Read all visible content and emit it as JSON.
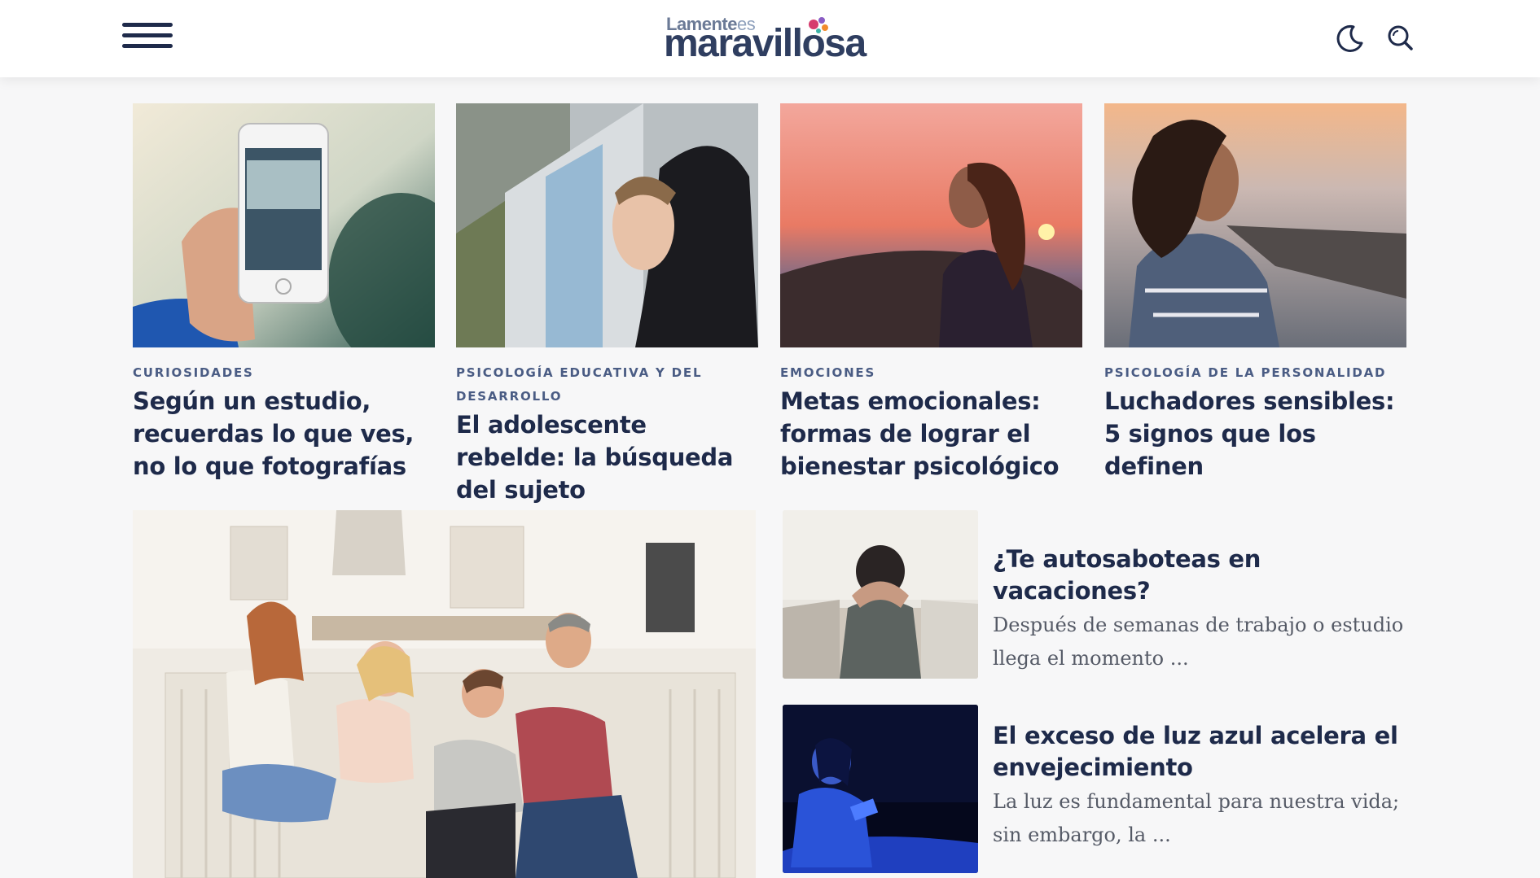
{
  "header": {
    "logo_small": "Lamente",
    "logo_small_es": "es",
    "logo_main": "maravillosa"
  },
  "cards": [
    {
      "category": "Curiosidades",
      "title": "Según un estudio, recuerdas lo que ves, no lo que fotografías"
    },
    {
      "category": "Psicología educativa y del desarrollo",
      "title": "El adolescente rebelde: la búsqueda del sujeto"
    },
    {
      "category": "Emociones",
      "title": "Metas emocionales: formas de lograr el bienestar psicológico"
    },
    {
      "category": "Psicología de la personalidad",
      "title": "Luchadores sensibles: 5 signos que los definen"
    }
  ],
  "side_items": [
    {
      "title": "¿Te autosaboteas en vacaciones?",
      "excerpt": "Después de semanas de trabajo o estudio llega el momento ..."
    },
    {
      "title": "El exceso de luz azul acelera el envejecimiento",
      "excerpt": "La luz es fundamental para nuestra vida; sin embargo, la ..."
    }
  ]
}
